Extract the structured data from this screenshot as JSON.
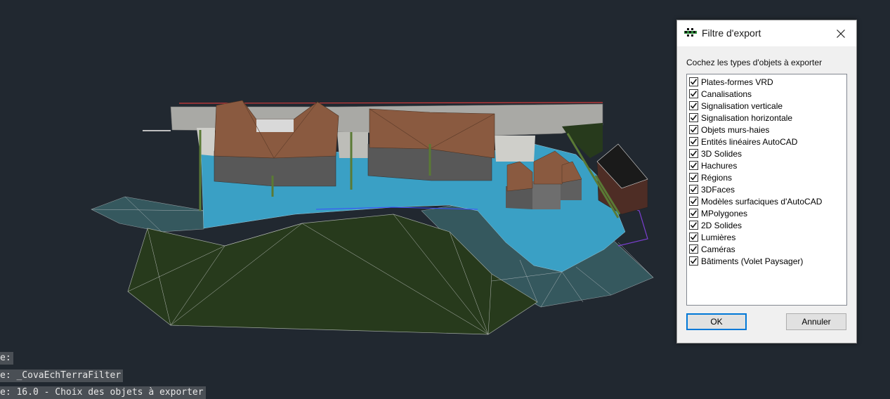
{
  "command_line": {
    "lines": [
      "e:",
      "e: _CovaEchTerraFilter",
      "e: 16.0 - Choix des objets à exporter"
    ]
  },
  "dialog": {
    "title": "Filtre d'export",
    "instruction": "Cochez les types d'objets à exporter",
    "items": [
      {
        "label": "Plates-formes VRD",
        "checked": true
      },
      {
        "label": "Canalisations",
        "checked": true
      },
      {
        "label": "Signalisation verticale",
        "checked": true
      },
      {
        "label": "Signalisation horizontale",
        "checked": true
      },
      {
        "label": "Objets murs-haies",
        "checked": true
      },
      {
        "label": "Entités linéaires AutoCAD",
        "checked": true
      },
      {
        "label": "3D Solides",
        "checked": true
      },
      {
        "label": "Hachures",
        "checked": true
      },
      {
        "label": "Régions",
        "checked": true
      },
      {
        "label": "3DFaces",
        "checked": true
      },
      {
        "label": "Modèles surfaciques d'AutoCAD",
        "checked": true
      },
      {
        "label": "MPolygones",
        "checked": true
      },
      {
        "label": "2D Solides",
        "checked": true
      },
      {
        "label": "Lumières",
        "checked": true
      },
      {
        "label": "Caméras",
        "checked": true
      },
      {
        "label": "Bâtiments (Volet Paysager)",
        "checked": true
      }
    ],
    "ok_label": "OK",
    "cancel_label": "Annuler"
  },
  "colors": {
    "background": "#212830",
    "terrain_dark": "#273a1c",
    "terrain_teal": "#35585e",
    "water": "#3aa0c5",
    "roof": "#8a5a40",
    "wall": "#555555",
    "accent": "#0078d7"
  }
}
